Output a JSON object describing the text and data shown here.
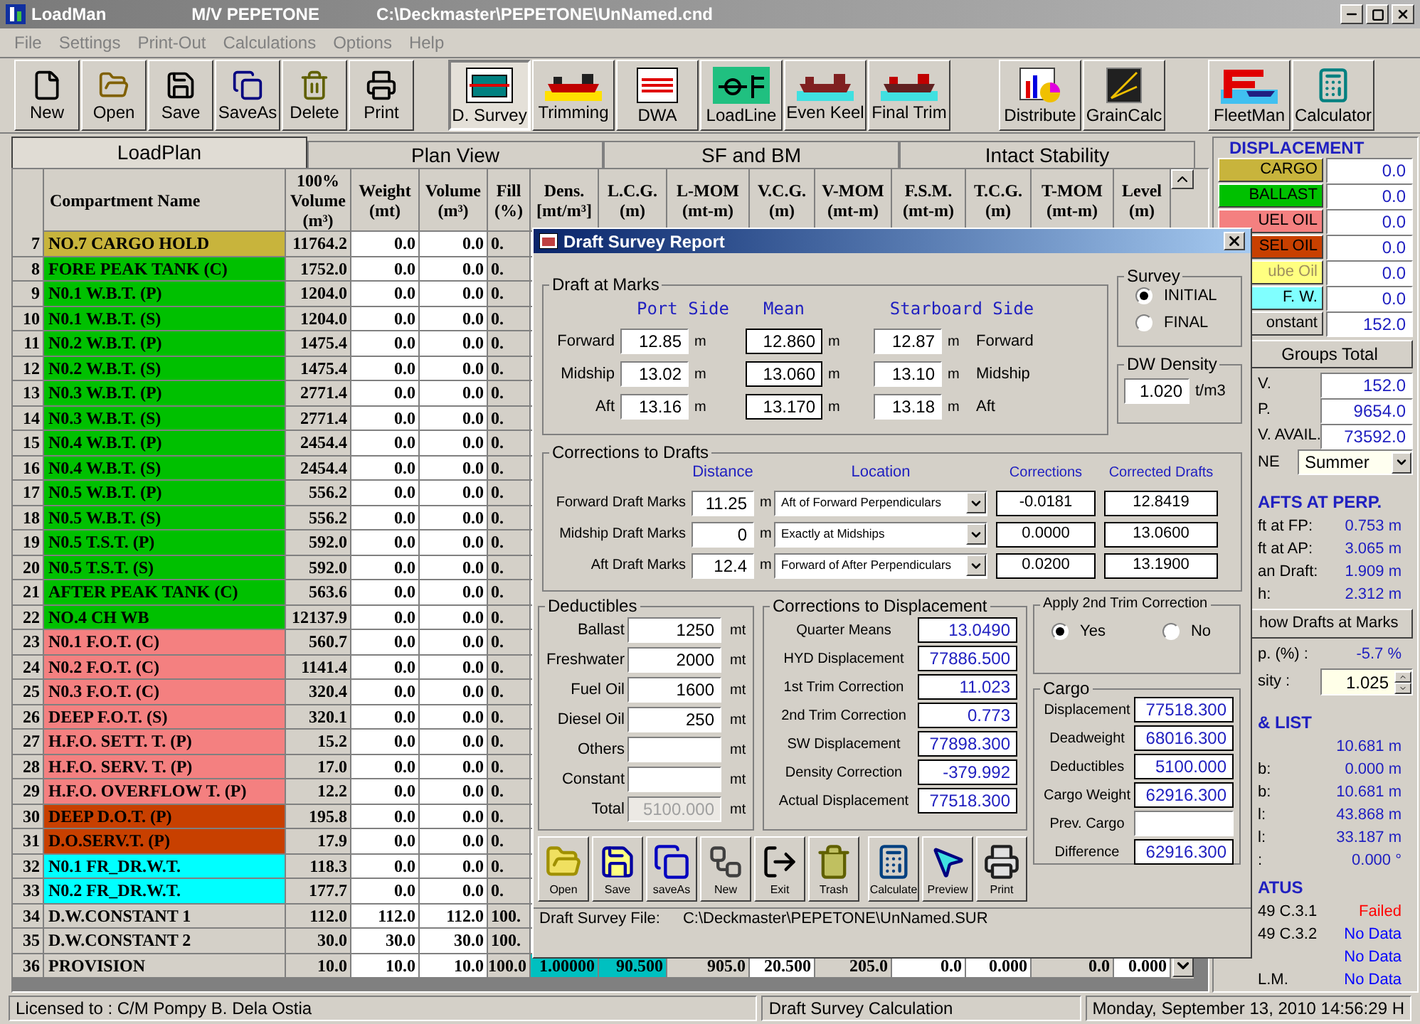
{
  "window": {
    "title": "LoadMan",
    "vessel": "M/V PEPETONE",
    "file": "C:\\Deckmaster\\PEPETONE\\UnNamed.cnd"
  },
  "menu": [
    "File",
    "Settings",
    "Print-Out",
    "Calculations",
    "Options",
    "Help"
  ],
  "toolbar": [
    {
      "buttons": [
        {
          "label": "New",
          "selected": false
        },
        {
          "label": "Open",
          "selected": false
        },
        {
          "label": "Save",
          "selected": false
        },
        {
          "label": "SaveAs",
          "selected": false
        },
        {
          "label": "Delete",
          "selected": false
        },
        {
          "label": "Print",
          "selected": false
        }
      ]
    },
    {
      "buttons": [
        {
          "label": "D. Survey",
          "selected": true
        },
        {
          "label": "Trimming",
          "selected": false
        },
        {
          "label": "DWA",
          "selected": false
        },
        {
          "label": "LoadLine",
          "selected": false
        },
        {
          "label": "Even Keel",
          "selected": false
        },
        {
          "label": "Final Trim",
          "selected": false
        }
      ]
    },
    {
      "buttons": [
        {
          "label": "Distribute",
          "selected": false
        },
        {
          "label": "GrainCalc",
          "selected": false
        }
      ]
    },
    {
      "buttons": [
        {
          "label": "FleetMan",
          "selected": false
        },
        {
          "label": "Calculator",
          "selected": false
        }
      ]
    }
  ],
  "tabs": [
    {
      "label": "LoadPlan",
      "selected": true
    },
    {
      "label": "Plan View",
      "selected": false
    },
    {
      "label": "SF and BM",
      "selected": false
    },
    {
      "label": "Intact Stability",
      "selected": false
    }
  ],
  "table": {
    "columns": [
      "",
      "Compartment Name",
      "100%\nVolume\n(m³)",
      "Weight\n(mt)",
      "Volume\n(m³)",
      "Fill\n(%)",
      "Dens.\n[mt/m³]",
      "L.C.G.\n(m)",
      "L-MOM\n(mt-m)",
      "V.C.G.\n(m)",
      "V-MOM\n(mt-m)",
      "F.S.M.\n(mt-m)",
      "T.C.G.\n(m)",
      "T-MOM\n(mt-m)",
      "Level\n(m)"
    ],
    "rows": [
      {
        "color": "#c8b43c",
        "cells": [
          "7",
          "NO.7 CARGO HOLD",
          "11764.2",
          "0.0",
          "0.0",
          "0."
        ]
      },
      {
        "color": "#00c000",
        "cells": [
          "8",
          "FORE PEAK TANK (C)",
          "1752.0",
          "0.0",
          "0.0",
          "0."
        ]
      },
      {
        "color": "#00c000",
        "cells": [
          "9",
          "N0.1 W.B.T. (P)",
          "1204.0",
          "0.0",
          "0.0",
          "0."
        ]
      },
      {
        "color": "#00c000",
        "cells": [
          "10",
          "N0.1 W.B.T. (S)",
          "1204.0",
          "0.0",
          "0.0",
          "0."
        ]
      },
      {
        "color": "#00c000",
        "cells": [
          "11",
          "N0.2 W.B.T. (P)",
          "1475.4",
          "0.0",
          "0.0",
          "0."
        ]
      },
      {
        "color": "#00c000",
        "cells": [
          "12",
          "N0.2 W.B.T. (S)",
          "1475.4",
          "0.0",
          "0.0",
          "0."
        ]
      },
      {
        "color": "#00c000",
        "cells": [
          "13",
          "N0.3 W.B.T. (P)",
          "2771.4",
          "0.0",
          "0.0",
          "0."
        ]
      },
      {
        "color": "#00c000",
        "cells": [
          "14",
          "N0.3 W.B.T. (S)",
          "2771.4",
          "0.0",
          "0.0",
          "0."
        ]
      },
      {
        "color": "#00c000",
        "cells": [
          "15",
          "N0.4 W.B.T. (P)",
          "2454.4",
          "0.0",
          "0.0",
          "0."
        ]
      },
      {
        "color": "#00c000",
        "cells": [
          "16",
          "N0.4 W.B.T. (S)",
          "2454.4",
          "0.0",
          "0.0",
          "0."
        ]
      },
      {
        "color": "#00c000",
        "cells": [
          "17",
          "N0.5 W.B.T. (P)",
          "556.2",
          "0.0",
          "0.0",
          "0."
        ]
      },
      {
        "color": "#00c000",
        "cells": [
          "18",
          "N0.5 W.B.T. (S)",
          "556.2",
          "0.0",
          "0.0",
          "0."
        ]
      },
      {
        "color": "#00c000",
        "cells": [
          "19",
          "N0.5 T.S.T. (P)",
          "592.0",
          "0.0",
          "0.0",
          "0."
        ]
      },
      {
        "color": "#00c000",
        "cells": [
          "20",
          "N0.5 T.S.T. (S)",
          "592.0",
          "0.0",
          "0.0",
          "0."
        ]
      },
      {
        "color": "#00c000",
        "cells": [
          "21",
          "AFTER PEAK TANK (C)",
          "563.6",
          "0.0",
          "0.0",
          "0."
        ]
      },
      {
        "color": "#00c000",
        "cells": [
          "22",
          "NO.4 CH WB",
          "12137.9",
          "0.0",
          "0.0",
          "0."
        ]
      },
      {
        "color": "#f48080",
        "cells": [
          "23",
          "N0.1 F.O.T. (C)",
          "560.7",
          "0.0",
          "0.0",
          "0."
        ]
      },
      {
        "color": "#f48080",
        "cells": [
          "24",
          "N0.2 F.O.T. (C)",
          "1141.4",
          "0.0",
          "0.0",
          "0."
        ]
      },
      {
        "color": "#f48080",
        "cells": [
          "25",
          "N0.3 F.O.T. (C)",
          "320.4",
          "0.0",
          "0.0",
          "0."
        ]
      },
      {
        "color": "#f48080",
        "cells": [
          "26",
          "DEEP F.O.T. (S)",
          "320.1",
          "0.0",
          "0.0",
          "0."
        ]
      },
      {
        "color": "#f48080",
        "cells": [
          "27",
          "H.F.O. SETT. T. (P)",
          "15.2",
          "0.0",
          "0.0",
          "0."
        ]
      },
      {
        "color": "#f48080",
        "cells": [
          "28",
          "H.F.O. SERV. T. (P)",
          "17.0",
          "0.0",
          "0.0",
          "0."
        ]
      },
      {
        "color": "#f48080",
        "cells": [
          "29",
          "H.F.O. OVERFLOW T. (P)",
          "12.2",
          "0.0",
          "0.0",
          "0."
        ]
      },
      {
        "color": "#c84000",
        "cells": [
          "30",
          "DEEP D.O.T. (P)",
          "195.8",
          "0.0",
          "0.0",
          "0."
        ]
      },
      {
        "color": "#c84000",
        "cells": [
          "31",
          "D.O.SERV.T. (P)",
          "17.9",
          "0.0",
          "0.0",
          "0."
        ]
      },
      {
        "color": "#00ffff",
        "cells": [
          "32",
          "N0.1 FR_DR.W.T.",
          "118.3",
          "0.0",
          "0.0",
          "0."
        ]
      },
      {
        "color": "#00ffff",
        "cells": [
          "33",
          "N0.2 FR_DR.W.T.",
          "177.7",
          "0.0",
          "0.0",
          "0."
        ]
      },
      {
        "color": "#d4d0c8",
        "cells": [
          "34",
          "D.W.CONSTANT 1",
          "112.0",
          "112.0",
          "112.0",
          "100."
        ]
      },
      {
        "color": "#d4d0c8",
        "cells": [
          "35",
          "D.W.CONSTANT 2",
          "30.0",
          "30.0",
          "30.0",
          "100."
        ]
      },
      {
        "color": "#d4d0c8",
        "cells": [
          "36",
          "PROVISION",
          {
            "text": "10.0",
            "highlighted": false
          },
          {
            "text": "10.0",
            "highlighted": false
          },
          {
            "text": "10.0",
            "highlighted": false
          },
          {
            "text": "100.0",
            "highlighted": false
          },
          {
            "text": "1.00000",
            "highlighted": true
          },
          {
            "text": "90.500",
            "highlighted": true
          },
          {
            "text": "905.0",
            "highlighted": false
          },
          {
            "text": "20.500",
            "highlighted": false
          },
          {
            "text": "205.0",
            "highlighted": false
          },
          {
            "text": "0.0",
            "highlighted": false
          },
          {
            "text": "0.000",
            "highlighted": false
          },
          {
            "text": "0.0",
            "highlighted": false
          },
          {
            "text": "0.000",
            "highlighted": false
          }
        ]
      }
    ]
  },
  "side_panel": {
    "displacement": {
      "title": "DISPLACEMENT",
      "groups": [
        {
          "label": "CARGO",
          "color": "#c8b43c",
          "value": "0.0"
        },
        {
          "label": "BALLAST",
          "color": "#00c000",
          "value": "0.0"
        },
        {
          "label": "UEL OIL",
          "color": "#f48080",
          "value": "0.0"
        },
        {
          "label": "SEL OIL",
          "color": "#c84000",
          "value": "0.0"
        },
        {
          "label": "ube Oil",
          "color": "#ffff80",
          "value": "0.0"
        },
        {
          "label": "F. W.",
          "color": "#80ffff",
          "value": "0.0"
        },
        {
          "label": "onstant",
          "color": "#d4d0c8",
          "value": "152.0"
        }
      ],
      "groups_total": "Groups Total",
      "rows": [
        {
          "label": "V.",
          "value": "152.0"
        },
        {
          "label": "P.",
          "value": "9654.0"
        },
        {
          "label": "V. AVAIL.",
          "value": "73592.0"
        }
      ],
      "zone": {
        "label": "NE",
        "value": "Summer"
      }
    },
    "drafts": {
      "title": "AFTS AT PERP.",
      "rows": [
        {
          "label": "ft at FP:",
          "value": "0.753 m"
        },
        {
          "label": "ft at AP:",
          "value": "3.065 m"
        },
        {
          "label": "an Draft:",
          "value": "1.909 m"
        },
        {
          "label": "h:",
          "value": "2.312 m"
        }
      ],
      "button": "how Drafts at Marks",
      "percent": {
        "label": "p. (%) :",
        "value": "-5.7 %"
      },
      "density": {
        "label": "sity :",
        "value": "1.025"
      }
    },
    "list": {
      "title": "& LIST",
      "rows": [
        {
          "value": "10.681 m"
        },
        {
          "label": "b:",
          "value": "0.000 m"
        },
        {
          "label": "b:",
          "value": "10.681 m"
        },
        {
          "label": "l:",
          "value": "43.868 m"
        },
        {
          "label": "l:",
          "value": "33.187 m"
        },
        {
          "label": ":",
          "value": "0.000 °"
        }
      ]
    },
    "status": {
      "title": "ATUS",
      "rows": [
        {
          "label": "49 C.3.1",
          "value": "Failed",
          "color": "#ff0000"
        },
        {
          "label": "49 C.3.2",
          "value": "No Data",
          "color": "#0000ff"
        },
        {
          "value": "No Data",
          "color": "#0000ff"
        },
        {
          "label": "L.M.",
          "value": "No Data",
          "color": "#0000ff"
        }
      ]
    }
  },
  "dialog": {
    "title": "Draft Survey Report",
    "draft_at_marks": {
      "title": "Draft at Marks",
      "headers": [
        "Port Side",
        "Mean",
        "Starboard Side"
      ],
      "rows": [
        {
          "label": "Forward",
          "port": "12.85",
          "port_unit": "m",
          "mean": "12.860",
          "mean_unit": "m",
          "starboard": "12.87",
          "starboard_unit": "m",
          "side_label": "Forward"
        },
        {
          "label": "Midship",
          "port": "13.02",
          "port_unit": "m",
          "mean": "13.060",
          "mean_unit": "m",
          "starboard": "13.10",
          "starboard_unit": "m",
          "side_label": "Midship"
        },
        {
          "label": "Aft",
          "port": "13.16",
          "port_unit": "m",
          "mean": "13.170",
          "mean_unit": "m",
          "starboard": "13.18",
          "starboard_unit": "m",
          "side_label": "Aft"
        }
      ]
    },
    "survey": {
      "title": "Survey",
      "options": [
        {
          "label": "INITIAL",
          "selected": true
        },
        {
          "label": "FINAL",
          "selected": false
        }
      ]
    },
    "dw_density": {
      "title": "DW Density",
      "value": "1.020",
      "unit": "t/m3"
    },
    "corrections_to_drafts": {
      "title": "Corrections to Drafts",
      "headers": [
        "Distance",
        "Location",
        "Corrections",
        "Corrected Drafts"
      ],
      "rows": [
        {
          "label": "Forward Draft Marks",
          "distance": "11.25",
          "unit": "m",
          "location": "Aft of Forward Perpendiculars",
          "correction": "-0.0181",
          "corrected": "12.8419"
        },
        {
          "label": "Midship Draft Marks",
          "distance": "0",
          "unit": "m",
          "location": "Exactly at Midships",
          "correction": "0.0000",
          "corrected": "13.0600"
        },
        {
          "label": "Aft Draft Marks",
          "distance": "12.4",
          "unit": "m",
          "location": "Forward of After Perpendiculars",
          "correction": "0.0200",
          "corrected": "13.1900"
        }
      ]
    },
    "deductibles": {
      "title": "Deductibles",
      "rows": [
        {
          "label": "Ballast",
          "value": "1250",
          "unit": "mt",
          "disabled": false
        },
        {
          "label": "Freshwater",
          "value": "2000",
          "unit": "mt",
          "disabled": false
        },
        {
          "label": "Fuel Oil",
          "value": "1600",
          "unit": "mt",
          "disabled": false
        },
        {
          "label": "Diesel Oil",
          "value": "250",
          "unit": "mt",
          "disabled": false
        },
        {
          "label": "Others",
          "unit": "mt",
          "disabled": false
        },
        {
          "label": "Constant",
          "unit": "mt",
          "disabled": false
        },
        {
          "label": "Total",
          "value": "5100.000",
          "unit": "mt",
          "disabled": true
        }
      ]
    },
    "corrections_to_displacement": {
      "title": "Corrections to Displacement",
      "rows": [
        {
          "label": "Quarter Means",
          "value": "13.0490"
        },
        {
          "label": "HYD Displacement",
          "value": "77886.500"
        },
        {
          "label": "1st Trim Correction",
          "value": "11.023"
        },
        {
          "label": "2nd Trim Correction",
          "value": "0.773"
        },
        {
          "label": "SW Displacement",
          "value": "77898.300"
        },
        {
          "label": "Density Correction",
          "value": "-379.992"
        },
        {
          "label": "Actual Displacement",
          "value": "77518.300"
        }
      ]
    },
    "trim_correction": {
      "title": "Apply 2nd Trim Correction",
      "options": [
        {
          "label": "Yes",
          "selected": true
        },
        {
          "label": "No",
          "selected": false
        }
      ]
    },
    "cargo": {
      "title": "Cargo",
      "rows": [
        {
          "label": "Displacement",
          "value": "77518.300"
        },
        {
          "label": "Deadweight",
          "value": "68016.300"
        },
        {
          "label": "Deductibles",
          "value": "5100.000"
        },
        {
          "label": "Cargo Weight",
          "value": "62916.300"
        },
        {
          "label": "Prev. Cargo"
        },
        {
          "label": "Difference",
          "value": "62916.300"
        }
      ]
    },
    "toolbar": [
      "Open",
      "Save",
      "saveAs",
      "New",
      "Exit",
      "Trash",
      "Calculate",
      "Preview",
      "Print"
    ],
    "file": {
      "label": "Draft Survey File:",
      "path": "C:\\Deckmaster\\PEPETONE\\UnNamed.SUR"
    }
  },
  "status_bar": [
    "Licensed to : C/M Pompy B. Dela Ostia",
    "Draft Survey Calculation",
    "Monday, September 13, 2010  14:56:29 H"
  ]
}
